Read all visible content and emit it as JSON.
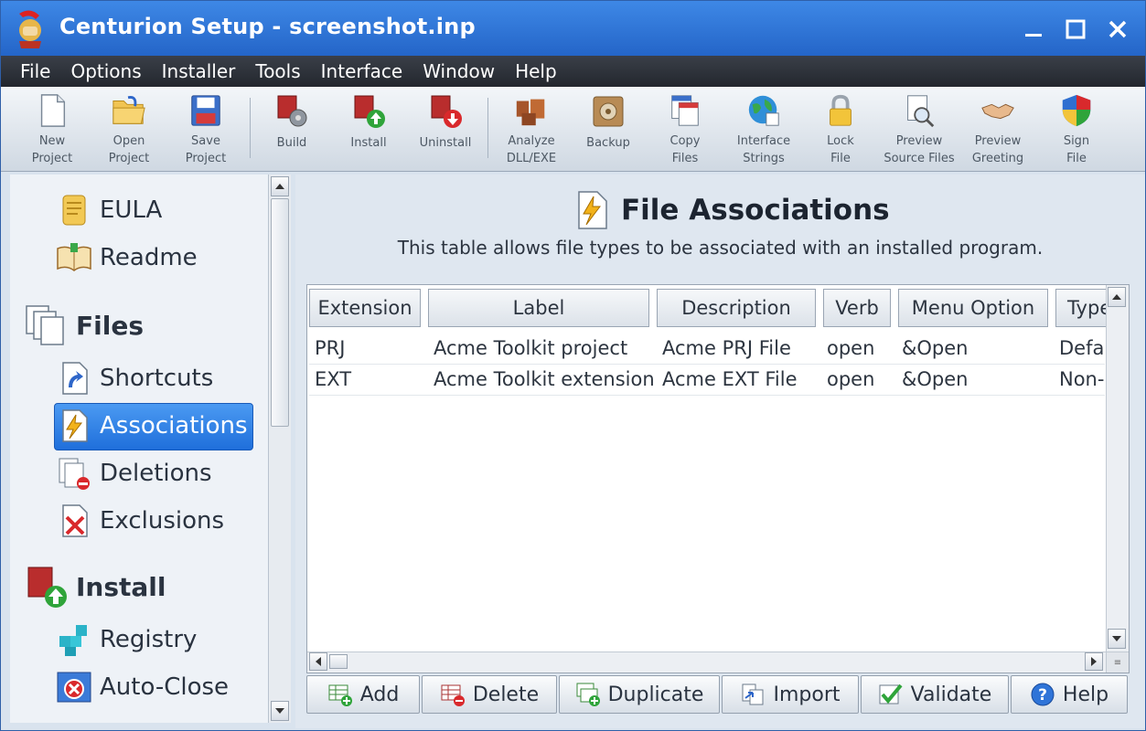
{
  "window": {
    "title": "Centurion Setup - screenshot.inp",
    "icons": {
      "app": "centurion-helmet-icon",
      "minimize": "minimize-icon",
      "maximize": "maximize-icon",
      "close": "close-icon"
    }
  },
  "menu": [
    "File",
    "Options",
    "Installer",
    "Tools",
    "Interface",
    "Window",
    "Help"
  ],
  "toolbar": [
    {
      "line1": "New",
      "line2": "Project",
      "icon": "new-project-icon"
    },
    {
      "line1": "Open",
      "line2": "Project",
      "icon": "open-project-icon"
    },
    {
      "line1": "Save",
      "line2": "Project",
      "icon": "save-project-icon"
    },
    {
      "line1": "Build",
      "line2": "",
      "icon": "build-icon"
    },
    {
      "line1": "Install",
      "line2": "",
      "icon": "install-icon"
    },
    {
      "line1": "Uninstall",
      "line2": "",
      "icon": "uninstall-icon"
    },
    {
      "line1": "Analyze",
      "line2": "DLL/EXE",
      "icon": "analyze-icon"
    },
    {
      "line1": "Backup",
      "line2": "",
      "icon": "backup-icon"
    },
    {
      "line1": "Copy",
      "line2": "Files",
      "icon": "copy-files-icon"
    },
    {
      "line1": "Interface",
      "line2": "Strings",
      "icon": "globe-icon"
    },
    {
      "line1": "Lock",
      "line2": "File",
      "icon": "lock-icon"
    },
    {
      "line1": "Preview",
      "line2": "Source Files",
      "icon": "preview-source-icon"
    },
    {
      "line1": "Preview",
      "line2": "Greeting",
      "icon": "handshake-icon"
    },
    {
      "line1": "Sign",
      "line2": "File",
      "icon": "shield-icon"
    }
  ],
  "sidebar": {
    "items": {
      "eula": "EULA",
      "readme": "Readme",
      "files": "Files",
      "shortcuts": "Shortcuts",
      "associations": "Associations",
      "deletions": "Deletions",
      "exclusions": "Exclusions",
      "install": "Install",
      "registry": "Registry",
      "autoclose": "Auto-Close"
    },
    "selected": "Associations"
  },
  "main": {
    "title": "File Associations",
    "description": "This table allows file types to be associated with an installed program.",
    "columns": [
      "Extension",
      "Label",
      "Description",
      "Verb",
      "Menu Option",
      "Type"
    ],
    "rows": [
      [
        "PRJ",
        "Acme Toolkit project",
        "Acme PRJ File",
        "open",
        "&Open",
        "Default"
      ],
      [
        "EXT",
        "Acme Toolkit extension",
        "Acme EXT File",
        "open",
        "&Open",
        "Non-default"
      ]
    ],
    "buttons": {
      "add": "Add",
      "delete": "Delete",
      "duplicate": "Duplicate",
      "import": "Import",
      "validate": "Validate",
      "help": "Help"
    }
  },
  "colors": {
    "titlebar": "#2f74d8",
    "menubar": "#2b2f36",
    "selection": "#2f80e8"
  }
}
